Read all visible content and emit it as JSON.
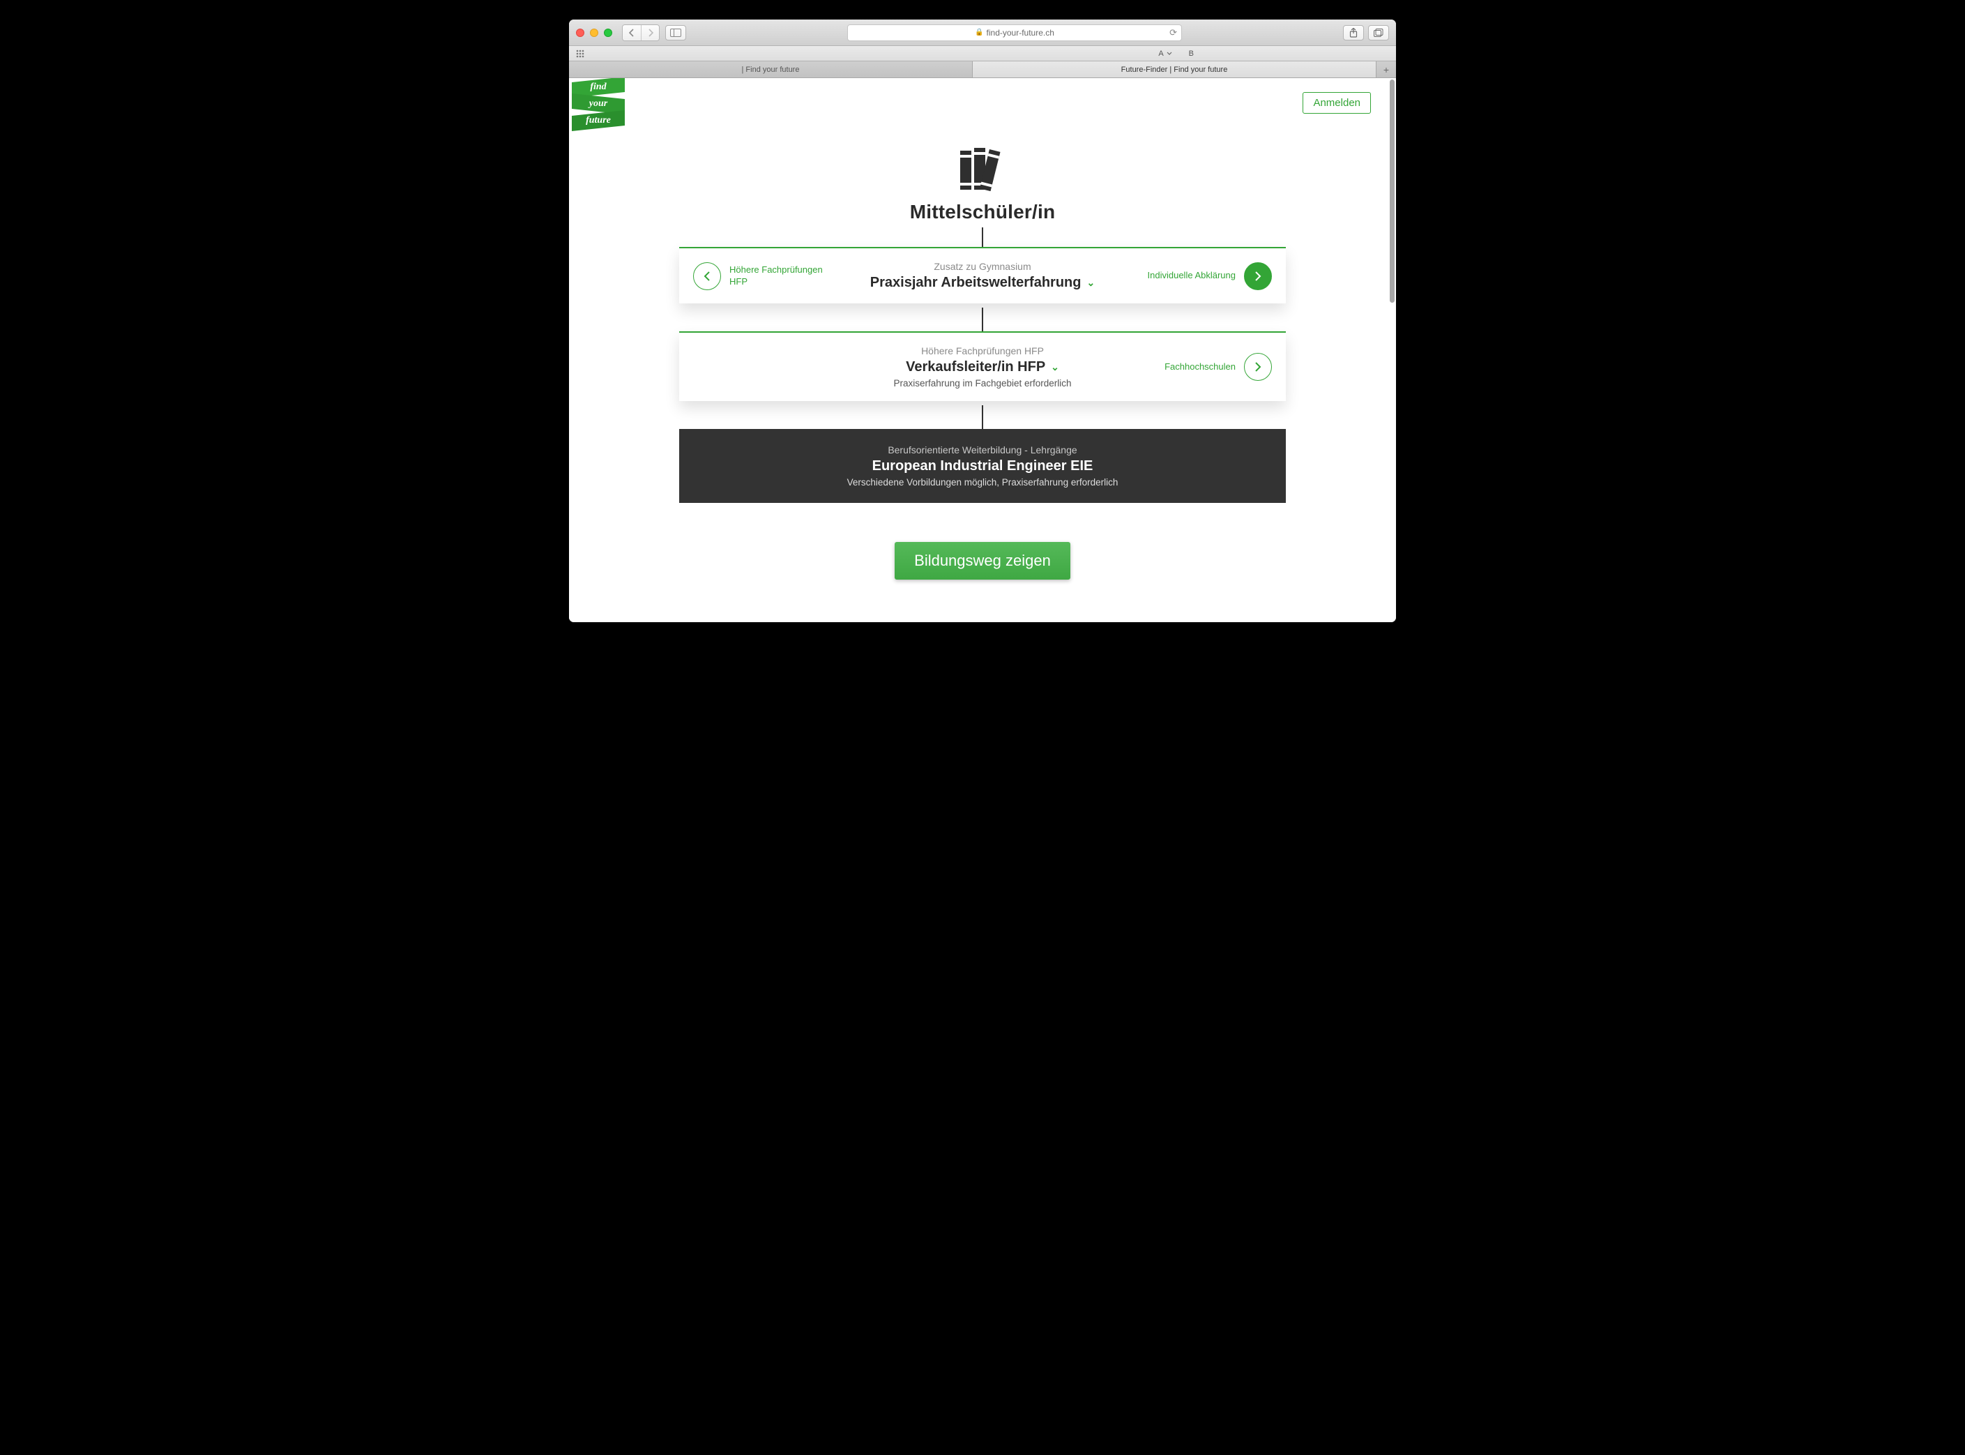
{
  "browser": {
    "url_host": "find-your-future.ch",
    "favorites": {
      "a": "A",
      "b": "B"
    },
    "tabs": [
      {
        "title": "| Find your future"
      },
      {
        "title": "Future-Finder | Find your future"
      }
    ]
  },
  "logo": {
    "l1": "find",
    "l2": "your",
    "l3": "future"
  },
  "header": {
    "login": "Anmelden"
  },
  "hero": {
    "title": "Mittelschüler/in"
  },
  "steps": [
    {
      "prev_label": "Höhere Fachprüfungen\nHFP",
      "subtitle": "Zusatz zu Gymnasium",
      "title": "Praxisjahr Arbeitswelterfahrung",
      "next_label": "Individuelle Abklärung",
      "next_style": "solid"
    },
    {
      "subtitle": "Höhere Fachprüfungen HFP",
      "title": "Verkaufsleiter/in HFP",
      "sub2": "Praxiserfahrung im Fachgebiet erforderlich",
      "next_label": "Fachhochschulen",
      "next_style": "outline"
    },
    {
      "dark": true,
      "subtitle": "Berufsorientierte Weiterbildung - Lehrgänge",
      "title": "European Industrial Engineer EIE",
      "sub2": "Verschiedene Vorbildungen möglich, Praxiserfahrung erforderlich"
    }
  ],
  "cta": {
    "label": "Bildungsweg zeigen"
  }
}
